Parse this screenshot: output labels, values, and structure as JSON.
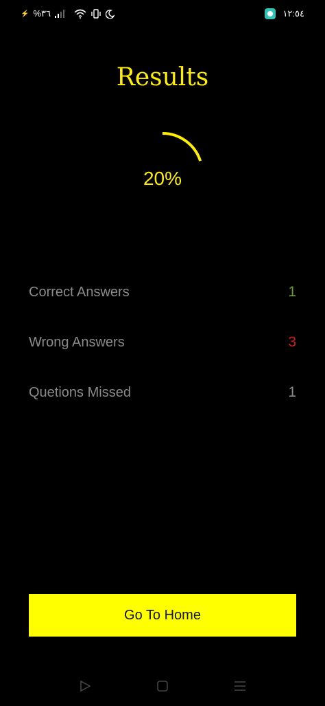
{
  "status_bar": {
    "battery_text": "%٣٦",
    "time": "١٢:٥٤"
  },
  "results": {
    "title": "Results",
    "percent_label": "20%",
    "progress_fraction": 0.2
  },
  "stats": [
    {
      "label": "Correct Answers",
      "value": "1",
      "color": "#6f9a2a"
    },
    {
      "label": "Wrong Answers",
      "value": "3",
      "color": "#d11a1a"
    },
    {
      "label": "Quetions Missed",
      "value": "1",
      "color": "#8a8a8a"
    }
  ],
  "colors": {
    "accent": "#ffee00",
    "button": "#ffff00",
    "background": "#000000"
  },
  "actions": {
    "home_label": "Go To Home"
  },
  "nav_icons": [
    "back-triangle-icon",
    "home-square-icon",
    "recents-menu-icon"
  ]
}
